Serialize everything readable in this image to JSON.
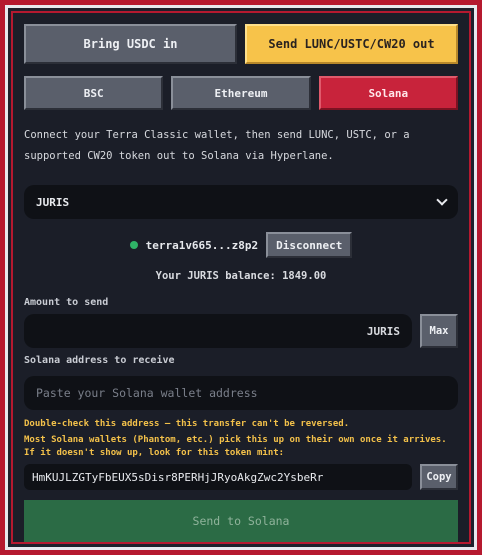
{
  "mode_tabs": {
    "bring": "Bring USDC in",
    "send": "Send LUNC/USTC/CW20 out"
  },
  "chain_tabs": [
    "BSC",
    "Ethereum",
    "Solana"
  ],
  "description": "Connect your Terra Classic wallet, then send LUNC, USTC, or a supported CW20 token out to Solana via Hyperlane.",
  "token_select": {
    "value": "JURIS"
  },
  "wallet": {
    "address": "terra1v665...z8p2",
    "disconnect_label": "Disconnect"
  },
  "balance_text": "Your JURIS balance: 1849.00",
  "amount": {
    "label": "Amount to send",
    "unit": "JURIS",
    "max_label": "Max"
  },
  "address_field": {
    "label": "Solana address to receive",
    "placeholder": "Paste your Solana wallet address"
  },
  "warning": "Double-check this address — this transfer can't be reversed.",
  "note": "Most Solana wallets (Phantom, etc.) pick this up on their own once it arrives. If it doesn't show up, look for this token mint:",
  "mint": {
    "value": "HmKUJLZGTyFbEUX5sDisr8PERHjJRyoAkgZwc2YsbeRr",
    "copy_label": "Copy"
  },
  "send_label": "Send to Solana",
  "colors": {
    "frame_red": "#b5192f",
    "accent_yellow": "#f7c34a",
    "active_red": "#c8233b",
    "send_green": "#2b6b45"
  }
}
